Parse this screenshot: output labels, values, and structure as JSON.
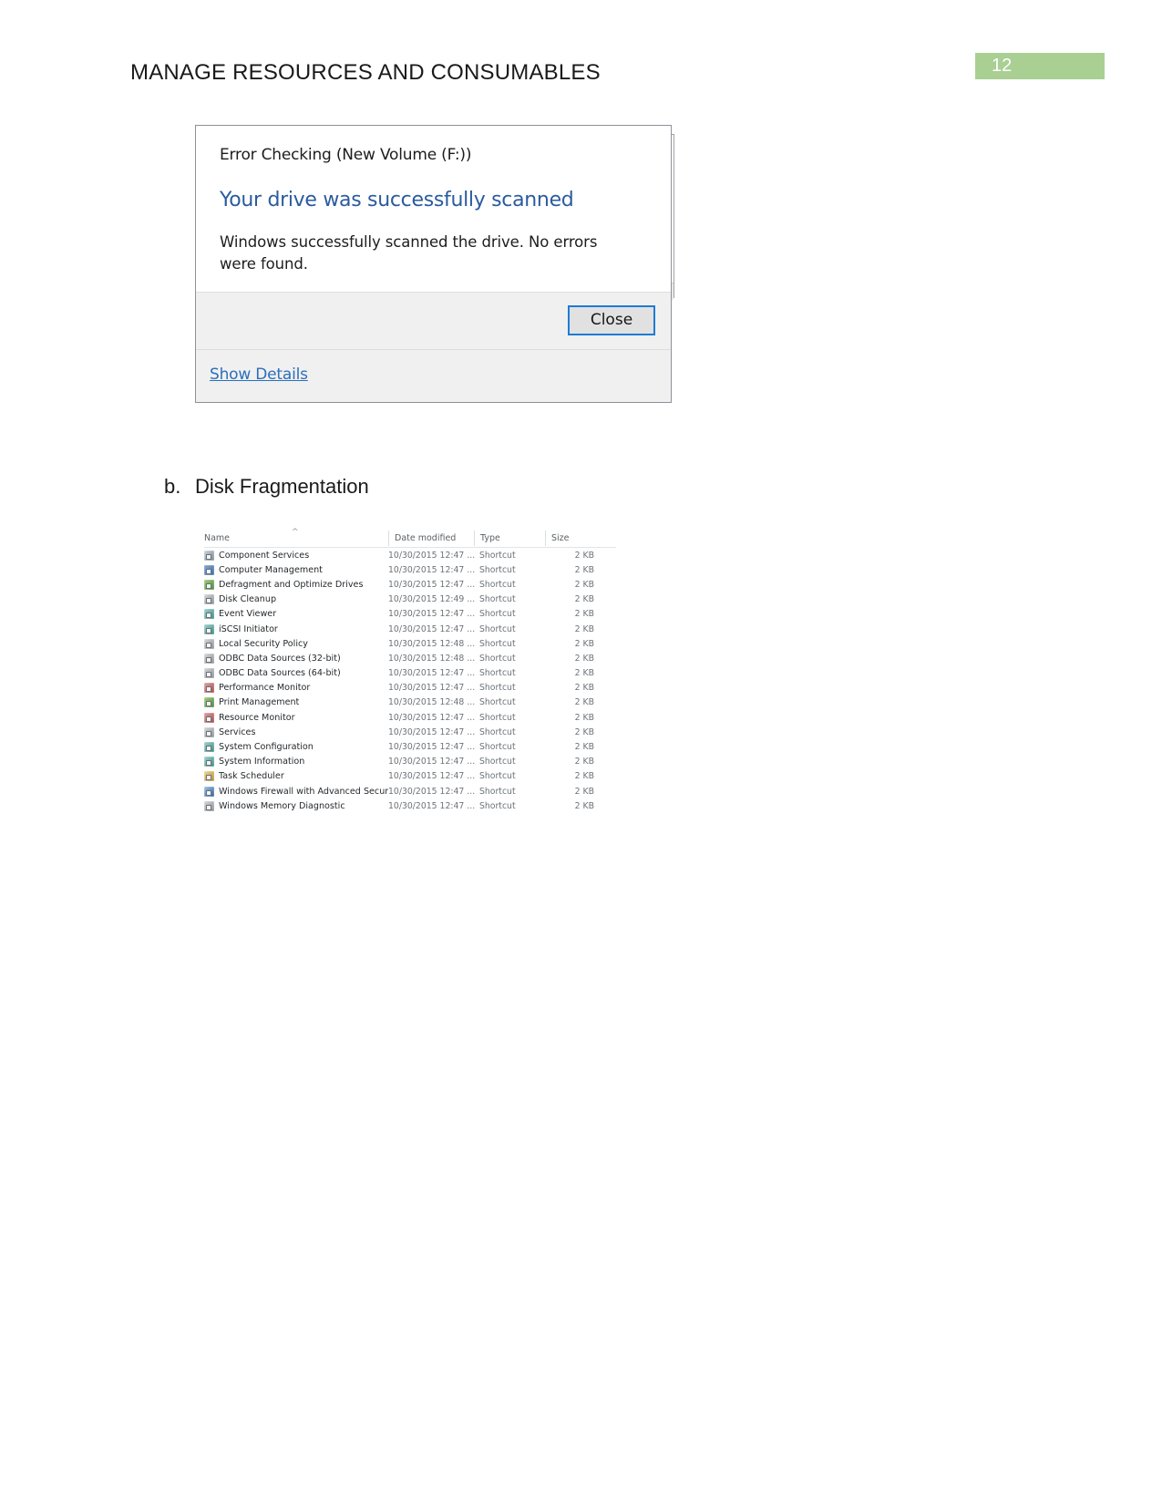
{
  "document": {
    "header_title": "MANAGE RESOURCES AND CONSUMABLES",
    "page_number": "12",
    "page_number_color": "#a9cf92"
  },
  "dialog": {
    "caption": "Error Checking (New Volume (F:))",
    "heading": "Your drive was successfully scanned",
    "heading_color": "#2b5b9e",
    "message": "Windows successfully scanned the drive. No errors were found.",
    "close_label": "Close",
    "show_details_label": "Show Details",
    "focus_color": "#1f7bd4"
  },
  "section": {
    "marker": "b.",
    "title": "Disk Fragmentation"
  },
  "explorer": {
    "columns": {
      "name": "Name",
      "date_modified": "Date modified",
      "type": "Type",
      "size": "Size"
    },
    "sort_indicator": "^",
    "rows": [
      {
        "name": "Component Services",
        "date": "10/30/2015 12:47 ...",
        "type": "Shortcut",
        "size": "2 KB",
        "icon": "component-services-icon"
      },
      {
        "name": "Computer Management",
        "date": "10/30/2015 12:47 ...",
        "type": "Shortcut",
        "size": "2 KB",
        "icon": "computer-management-icon"
      },
      {
        "name": "Defragment and Optimize Drives",
        "date": "10/30/2015 12:47 ...",
        "type": "Shortcut",
        "size": "2 KB",
        "icon": "defragment-icon"
      },
      {
        "name": "Disk Cleanup",
        "date": "10/30/2015 12:49 ...",
        "type": "Shortcut",
        "size": "2 KB",
        "icon": "disk-cleanup-icon"
      },
      {
        "name": "Event Viewer",
        "date": "10/30/2015 12:47 ...",
        "type": "Shortcut",
        "size": "2 KB",
        "icon": "event-viewer-icon"
      },
      {
        "name": "iSCSI Initiator",
        "date": "10/30/2015 12:47 ...",
        "type": "Shortcut",
        "size": "2 KB",
        "icon": "iscsi-initiator-icon"
      },
      {
        "name": "Local Security Policy",
        "date": "10/30/2015 12:48 ...",
        "type": "Shortcut",
        "size": "2 KB",
        "icon": "local-security-policy-icon"
      },
      {
        "name": "ODBC Data Sources (32-bit)",
        "date": "10/30/2015 12:48 ...",
        "type": "Shortcut",
        "size": "2 KB",
        "icon": "odbc-32-icon"
      },
      {
        "name": "ODBC Data Sources (64-bit)",
        "date": "10/30/2015 12:47 ...",
        "type": "Shortcut",
        "size": "2 KB",
        "icon": "odbc-64-icon"
      },
      {
        "name": "Performance Monitor",
        "date": "10/30/2015 12:47 ...",
        "type": "Shortcut",
        "size": "2 KB",
        "icon": "performance-monitor-icon"
      },
      {
        "name": "Print Management",
        "date": "10/30/2015 12:48 ...",
        "type": "Shortcut",
        "size": "2 KB",
        "icon": "print-management-icon"
      },
      {
        "name": "Resource Monitor",
        "date": "10/30/2015 12:47 ...",
        "type": "Shortcut",
        "size": "2 KB",
        "icon": "resource-monitor-icon"
      },
      {
        "name": "Services",
        "date": "10/30/2015 12:47 ...",
        "type": "Shortcut",
        "size": "2 KB",
        "icon": "services-icon"
      },
      {
        "name": "System Configuration",
        "date": "10/30/2015 12:47 ...",
        "type": "Shortcut",
        "size": "2 KB",
        "icon": "system-configuration-icon"
      },
      {
        "name": "System Information",
        "date": "10/30/2015 12:47 ...",
        "type": "Shortcut",
        "size": "2 KB",
        "icon": "system-information-icon"
      },
      {
        "name": "Task Scheduler",
        "date": "10/30/2015 12:47 ...",
        "type": "Shortcut",
        "size": "2 KB",
        "icon": "task-scheduler-icon"
      },
      {
        "name": "Windows Firewall with Advanced Security",
        "date": "10/30/2015 12:47 ...",
        "type": "Shortcut",
        "size": "2 KB",
        "icon": "windows-firewall-icon"
      },
      {
        "name": "Windows Memory Diagnostic",
        "date": "10/30/2015 12:47 ...",
        "type": "Shortcut",
        "size": "2 KB",
        "icon": "memory-diagnostic-icon"
      }
    ]
  }
}
